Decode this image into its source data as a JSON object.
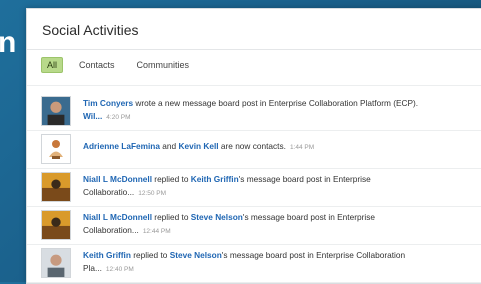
{
  "background": {
    "partial_text": "n"
  },
  "panel": {
    "title": "Social Activities"
  },
  "tabs": [
    {
      "label": "All",
      "active": true
    },
    {
      "label": "Contacts",
      "active": false
    },
    {
      "label": "Communities",
      "active": false
    }
  ],
  "feed": [
    {
      "actor": "Tim Conyers",
      "text1": " wrote a new message board post in Enterprise Collaboration Platform (ECP).",
      "link2": "Wil...",
      "time": "4:20 PM"
    },
    {
      "actor": "Adrienne LaFemina",
      "text1": " and ",
      "link2": "Kevin Kell",
      "text2": " are now contacts.",
      "time": "1:44 PM"
    },
    {
      "actor": "Niall L McDonnell",
      "text1": " replied to ",
      "link2": "Keith Griffin",
      "text2": "'s message board post in Enterprise",
      "link3": "Collaboratio...",
      "time": "12:50 PM"
    },
    {
      "actor": "Niall L McDonnell",
      "text1": " replied to ",
      "link2": "Steve Nelson",
      "text2": "'s message board post in Enterprise",
      "link3": "Collaboration...",
      "time": "12:44 PM"
    },
    {
      "actor": "Keith Griffin",
      "text1": " replied to ",
      "link2": "Steve Nelson",
      "text2": "'s message board post in Enterprise Collaboration",
      "link3": "Pla...",
      "time": "12:40 PM"
    }
  ],
  "colors": {
    "link": "#1f66b3",
    "active_tab": "#b8d98a"
  },
  "icons": [
    "avatar-photo-icon",
    "avatar-default-icon"
  ]
}
